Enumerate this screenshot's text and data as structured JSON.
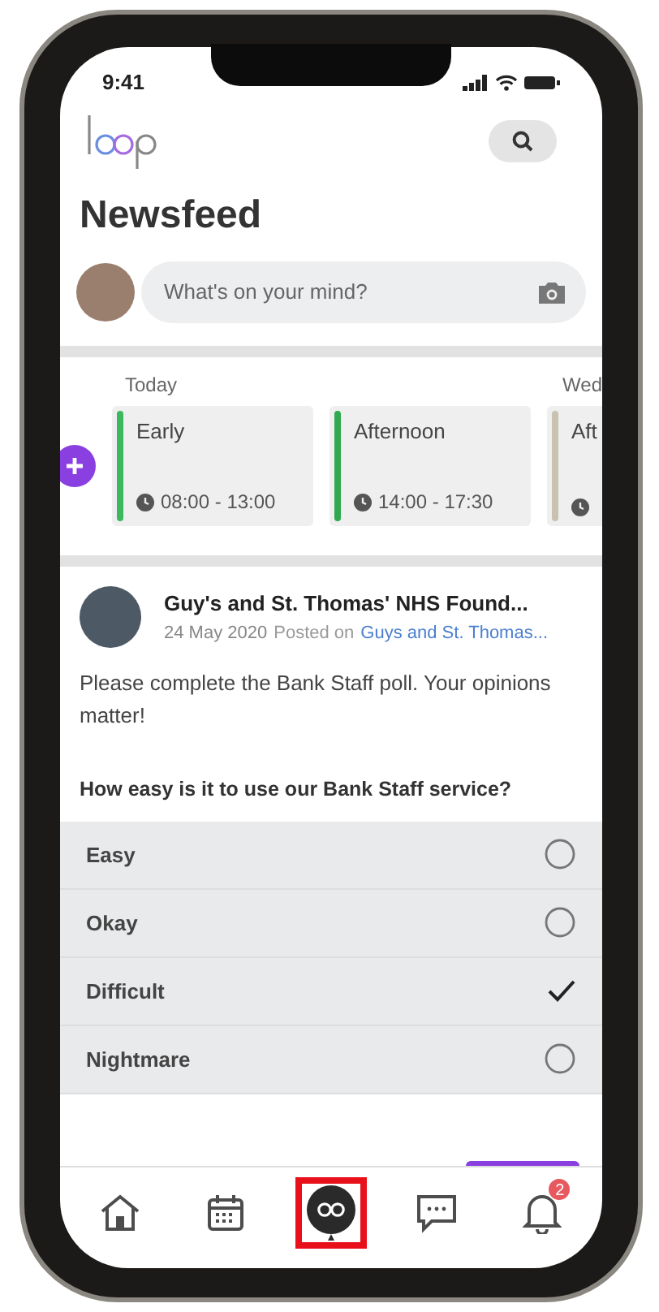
{
  "status_bar": {
    "time": "9:41"
  },
  "header": {
    "title": "Newsfeed"
  },
  "composer": {
    "placeholder": "What's on your mind?"
  },
  "shifts": {
    "days": [
      {
        "label": "Today"
      },
      {
        "label": "Wed"
      }
    ],
    "cards": [
      {
        "title": "Early",
        "time": "08:00 - 13:00",
        "color": "#3cb95f"
      },
      {
        "title": "Afternoon",
        "time": "14:00 - 17:30",
        "color": "#2fa84f"
      },
      {
        "title": "Aft",
        "color": "#c9c2b0"
      }
    ]
  },
  "post": {
    "author": "Guy's and St. Thomas' NHS Found...",
    "date": "24 May 2020",
    "posted_on_label": "Posted on",
    "posted_on_link": "Guys and St. Thomas...",
    "body": "Please complete the Bank Staff poll. Your opinions matter!",
    "poll": {
      "question": "How easy is it to use our Bank Staff service?",
      "options": [
        {
          "label": "Easy",
          "selected": false
        },
        {
          "label": "Okay",
          "selected": false
        },
        {
          "label": "Difficult",
          "selected": true
        },
        {
          "label": "Nightmare",
          "selected": false
        }
      ]
    }
  },
  "tab_bar": [
    {
      "kind": "home",
      "selected": false,
      "highlighted": false
    },
    {
      "kind": "calendar",
      "selected": false,
      "highlighted": false
    },
    {
      "kind": "loop",
      "selected": true,
      "highlighted": true
    },
    {
      "kind": "chat",
      "selected": false,
      "highlighted": false
    },
    {
      "kind": "bell",
      "selected": false,
      "highlighted": false,
      "badge": "2"
    }
  ]
}
